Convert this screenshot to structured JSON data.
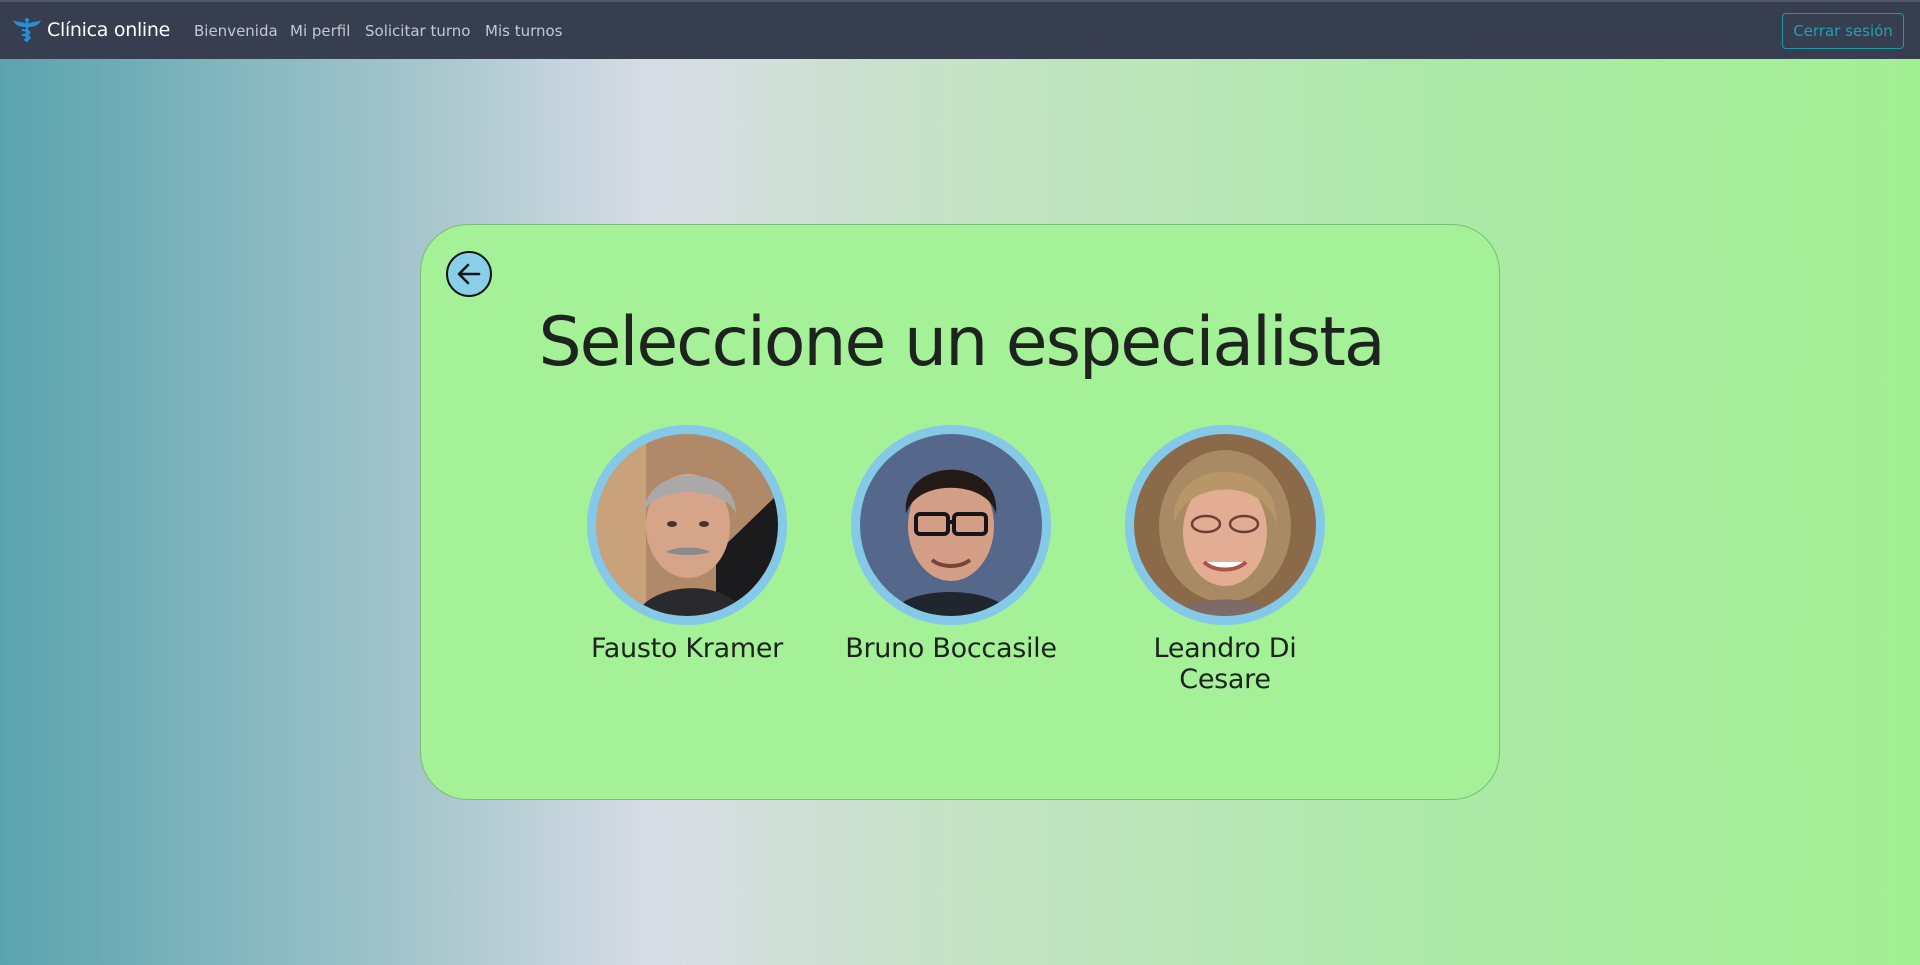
{
  "navbar": {
    "brand": "Clínica online",
    "brand_icon": "caduceus-icon",
    "links": [
      "Bienvenida",
      "Mi perfil",
      "Solicitar turno",
      "Mis turnos"
    ],
    "logout_label": "Cerrar sesión"
  },
  "page": {
    "title": "Seleccione un especialista",
    "back_icon": "arrow-left-icon"
  },
  "specialists": [
    {
      "name": "Fausto Kramer"
    },
    {
      "name": "Bruno Boccasile"
    },
    {
      "name": "Leandro Di Cesare"
    }
  ],
  "colors": {
    "navbar_bg": "#373e4f",
    "card_bg": "#a4f198",
    "avatar_ring": "#84c9e8",
    "logout_accent": "#21a0ae"
  }
}
